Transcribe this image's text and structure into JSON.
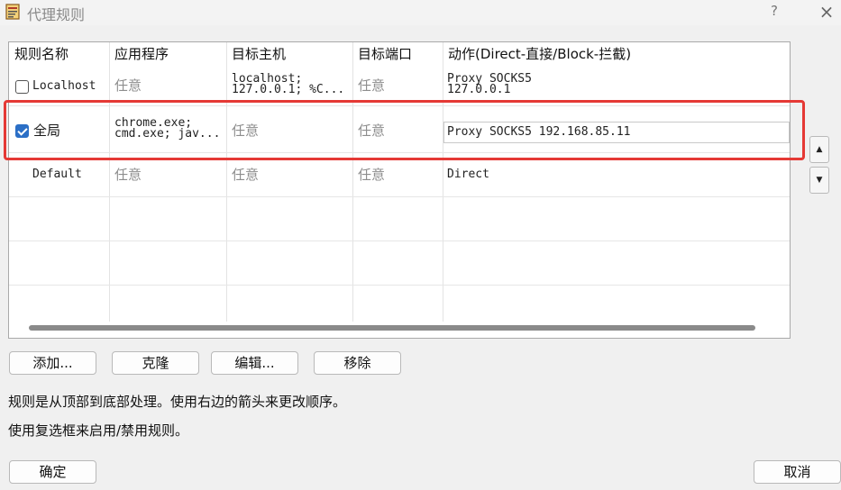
{
  "window": {
    "title": "代理规则",
    "help_label": "?",
    "close_label": "×"
  },
  "columns": [
    "规则名称",
    "应用程序",
    "目标主机",
    "目标端口",
    "动作(Direct-直接/Block-拦截)"
  ],
  "rows": [
    {
      "checkbox": true,
      "checked": false,
      "name": "Localhost",
      "apps": "任意",
      "hosts_line1": "localhost;",
      "hosts_line2": "127.0.0.1; %C...",
      "ports": "任意",
      "action_line1": "Proxy SOCKS5",
      "action_line2": "127.0.0.1"
    },
    {
      "checkbox": true,
      "checked": true,
      "name": "全局",
      "apps_line1": "chrome.exe;",
      "apps_line2": "cmd.exe; jav...",
      "hosts": "任意",
      "ports": "任意",
      "action": "Proxy SOCKS5 192.168.85.11"
    },
    {
      "checkbox": false,
      "name": "Default",
      "apps": "任意",
      "hosts": "任意",
      "ports": "任意",
      "action": "Direct"
    }
  ],
  "buttons": {
    "add": "添加...",
    "clone": "克隆",
    "edit": "编辑...",
    "remove": "移除",
    "ok": "确定",
    "cancel": "取消"
  },
  "help": {
    "line1": "规则是从顶部到底部处理。使用右边的箭头来更改顺序。",
    "line2": "使用复选框来启用/禁用规则。"
  },
  "arrows": {
    "up": "▲",
    "down": "▼"
  },
  "colors": {
    "highlight": "#e53935",
    "checkbox_checked": "#2b6fc6"
  },
  "icons": [
    "app-icon",
    "checkbox-icon",
    "up-arrow-icon",
    "down-arrow-icon",
    "close-icon"
  ]
}
